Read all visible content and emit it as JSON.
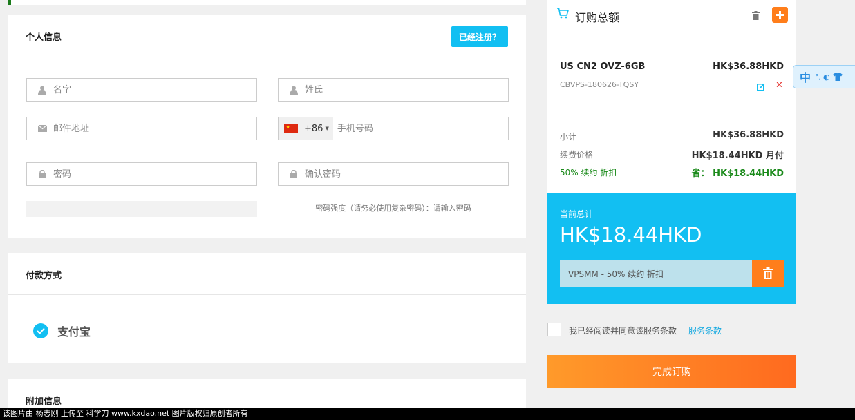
{
  "personal": {
    "title": "个人信息",
    "registered_button": "已经注册？",
    "first_name_placeholder": "名字",
    "last_name_placeholder": "姓氏",
    "email_placeholder": "邮件地址",
    "phone_code": "+86",
    "phone_placeholder": "手机号码",
    "password_placeholder": "密码",
    "confirm_password_placeholder": "确认密码",
    "password_strength": "密码强度（请务必使用复杂密码）：请输入密码"
  },
  "payment": {
    "title": "付款方式",
    "method": "支付宝"
  },
  "additional": {
    "title": "附加信息"
  },
  "order": {
    "title": "订购总额",
    "product_name": "US CN2 OVZ-6GB",
    "product_price": "HK$36.88HKD",
    "product_code": "CBVPS-180626-TQSY",
    "subtotal_label": "小计",
    "subtotal_value": "HK$36.88HKD",
    "renewal_label": "续费价格",
    "renewal_value": "HK$18.44HKD 月付",
    "discount_label": "50% 续约 折扣",
    "discount_value": "省： HK$18.44HKD",
    "total_label": "当前总计",
    "total_value": "HK$18.44HKD",
    "promo_code": "VPSMM - 50% 续约 折扣",
    "tos_text": "我已经阅读并同意该服务条款",
    "tos_link": "服务条款",
    "checkout_button": "完成订购"
  },
  "ime": {
    "label": "中"
  },
  "watermark": {
    "text": "该图片由 杨志刚 上传至 科学刀 www.kxdao.net 图片版权归原创者所有"
  },
  "colors": {
    "accent": "#12bff2",
    "orange": "#ff7e1b",
    "green": "#1a8a1a"
  }
}
